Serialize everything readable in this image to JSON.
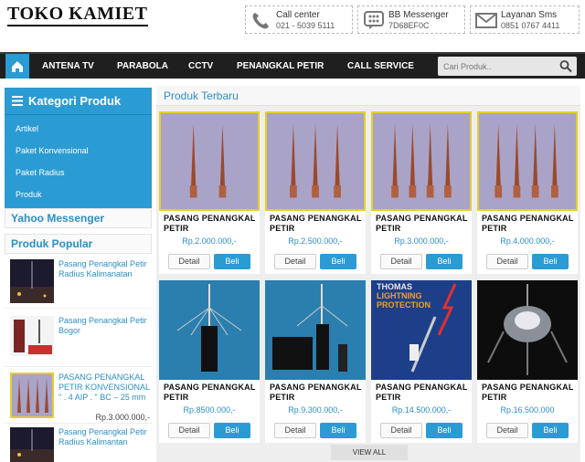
{
  "site": {
    "title": "TOKO KAMIET"
  },
  "contacts": [
    {
      "label": "Call center",
      "value": "021 - 5039 5111",
      "icon": "phone-icon"
    },
    {
      "label": "BB Messenger",
      "value": "7D68EF0C",
      "icon": "bbm-icon"
    },
    {
      "label": "Layanan Sms",
      "value": "0851 0767 4411",
      "icon": "envelope-icon"
    }
  ],
  "nav": {
    "items": [
      "ANTENA TV",
      "PARABOLA",
      "CCTV",
      "PENANGKAL PETIR",
      "CALL SERVICE"
    ],
    "search_placeholder": "Cari Produk.."
  },
  "sidebar": {
    "kategori_title": "Kategori Produk",
    "kategori_items": [
      "Artikel",
      "Paket Konvensional",
      "Paket Radius",
      "Produk"
    ],
    "yahoo_title": "Yahoo Messenger",
    "popular_title": "Produk Popular",
    "popular": [
      {
        "title": "Pasang Penangkal Petir Radius Kalimanatan",
        "price": ""
      },
      {
        "title": "Pasang Penangkal Petir Bogor",
        "price": ""
      },
      {
        "title": "PASANG PENANGKAL PETIR KONVENSIONAL \" . 4 AIP . \" BC – 25 mm",
        "price": "Rp.3.000.000,-"
      },
      {
        "title": "Pasang Penangkal Petir Radius Kalimantan",
        "price": ""
      }
    ]
  },
  "main": {
    "heading": "Produk Terbaru",
    "detail_label": "Detail",
    "buy_label": "Beli",
    "view_all": "VIEW ALL",
    "products": [
      {
        "name": "PASANG PENANGKAL PETIR",
        "price": "Rp.2.000.000,-"
      },
      {
        "name": "PASANG PENANGKAL PETIR",
        "price": "Rp.2.500.000,-"
      },
      {
        "name": "PASANG PENANGKAL PETIR",
        "price": "Rp.3.000.000,-"
      },
      {
        "name": "PASANG PENANGKAL PETIR",
        "price": "Rp.4.000.000,-"
      },
      {
        "name": "PASANG PENANGKAL PETIR",
        "price": "Rp.8500.000,-"
      },
      {
        "name": "PASANG PENANGKAL PETIR",
        "price": "Rp.9.300.000,-"
      },
      {
        "name": "PASANG PENANGKAL PETIR",
        "price": "Rp.14.500.000,-"
      },
      {
        "name": "PASANG PENANGKAL PETIR",
        "price": "Rp.16.500.000"
      }
    ],
    "product3_image_text": "THOMAS LIGHTNING PROTECTION"
  },
  "colors": {
    "accent": "#2b9bd3",
    "nav": "#1f1f1f",
    "frame": "#e4cf2a"
  }
}
